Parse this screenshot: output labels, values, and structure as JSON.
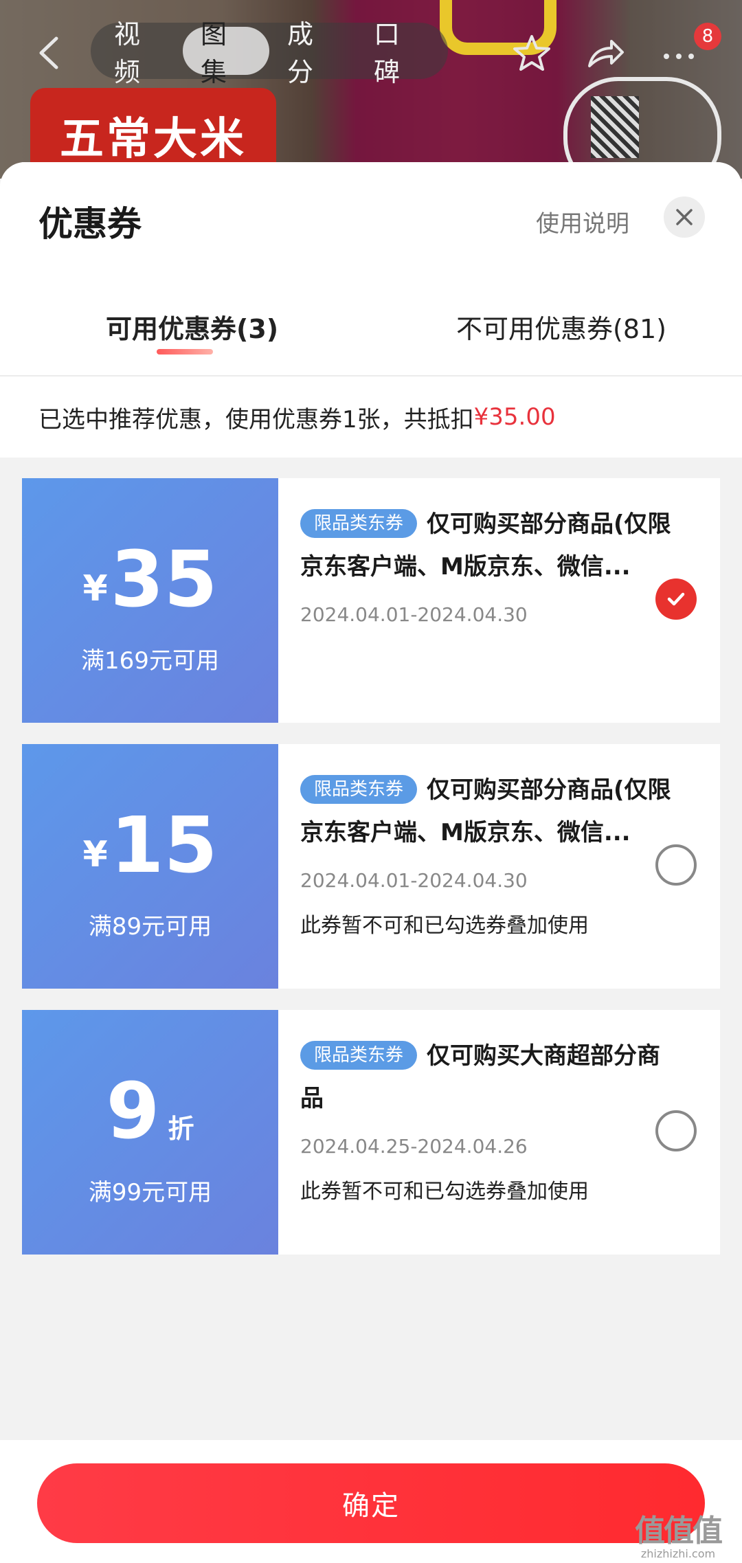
{
  "top_nav": {
    "tabs": [
      "视频",
      "图集",
      "成分",
      "口碑"
    ],
    "active_tab_index": 1,
    "message_badge": "8"
  },
  "background": {
    "product_label": "五常大米"
  },
  "sheet": {
    "title": "优惠券",
    "help_link": "使用说明",
    "tabs": {
      "available": "可用优惠券(3)",
      "unavailable": "不可用优惠券(81)"
    },
    "summary_prefix": "已选中推荐优惠，使用优惠券1张，共抵扣",
    "summary_amount": "¥35.00"
  },
  "coupons": [
    {
      "currency": "¥",
      "value": "35",
      "unit": "",
      "threshold": "满169元可用",
      "tag": "限品类东券",
      "title": "仅可购买部分商品(仅限京东客户端、M版京东、微信...",
      "date": "2024.04.01-2024.04.30",
      "note": "",
      "selected": true
    },
    {
      "currency": "¥",
      "value": "15",
      "unit": "",
      "threshold": "满89元可用",
      "tag": "限品类东券",
      "title": "仅可购买部分商品(仅限京东客户端、M版京东、微信...",
      "date": "2024.04.01-2024.04.30",
      "note": "此券暂不可和已勾选券叠加使用",
      "selected": false
    },
    {
      "currency": "",
      "value": "9",
      "unit": "折",
      "threshold": "满99元可用",
      "tag": "限品类东券",
      "title": "仅可购买大商超部分商品",
      "date": "2024.04.25-2024.04.26",
      "note": "此券暂不可和已勾选券叠加使用",
      "selected": false
    }
  ],
  "footer": {
    "confirm_label": "确定"
  },
  "watermark": {
    "logo": "值值值",
    "url": "zhizhizhi.com"
  },
  "colors": {
    "accent_red": "#e8323c",
    "coupon_blue": "#5d98ea",
    "tag_blue": "#5b9be5"
  }
}
